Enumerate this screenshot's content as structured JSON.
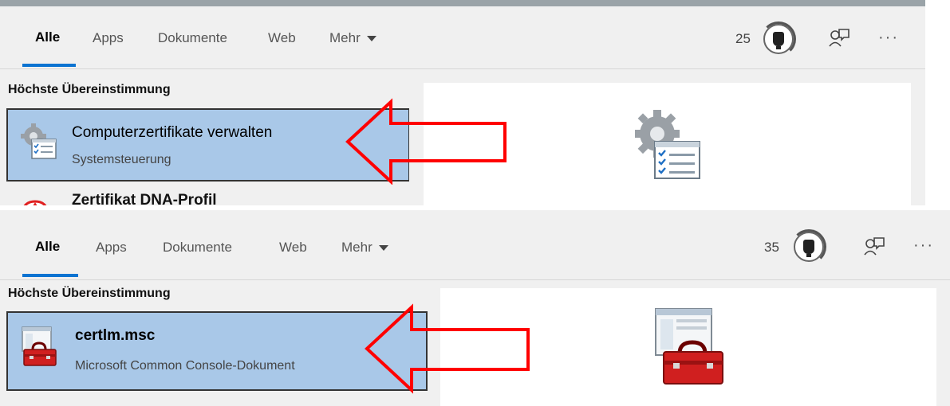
{
  "screen1": {
    "tabs": [
      "Alle",
      "Apps",
      "Dokumente",
      "Web",
      "Mehr"
    ],
    "rewards_count": "25",
    "more_label": "···",
    "section_header": "Höchste Übereinstimmung",
    "best_match": {
      "title": "Computerzertifikate verwalten",
      "subtitle": "Systemsteuerung",
      "icon": "certificate-settings-icon"
    },
    "next_result_label": "Zertifikat DNA-Profil"
  },
  "screen2": {
    "tabs": [
      "Alle",
      "Apps",
      "Dokumente",
      "Web",
      "Mehr"
    ],
    "rewards_count": "35",
    "more_label": "···",
    "section_header": "Höchste Übereinstimmung",
    "best_match": {
      "title": "certlm.msc",
      "subtitle": "Microsoft Common Console-Dokument",
      "icon": "toolbox-icon"
    }
  },
  "colors": {
    "accent": "#0b73d1",
    "selection": "#a9c8e8",
    "arrow": "#ff0000",
    "pane_bg": "#f0f0f0"
  }
}
